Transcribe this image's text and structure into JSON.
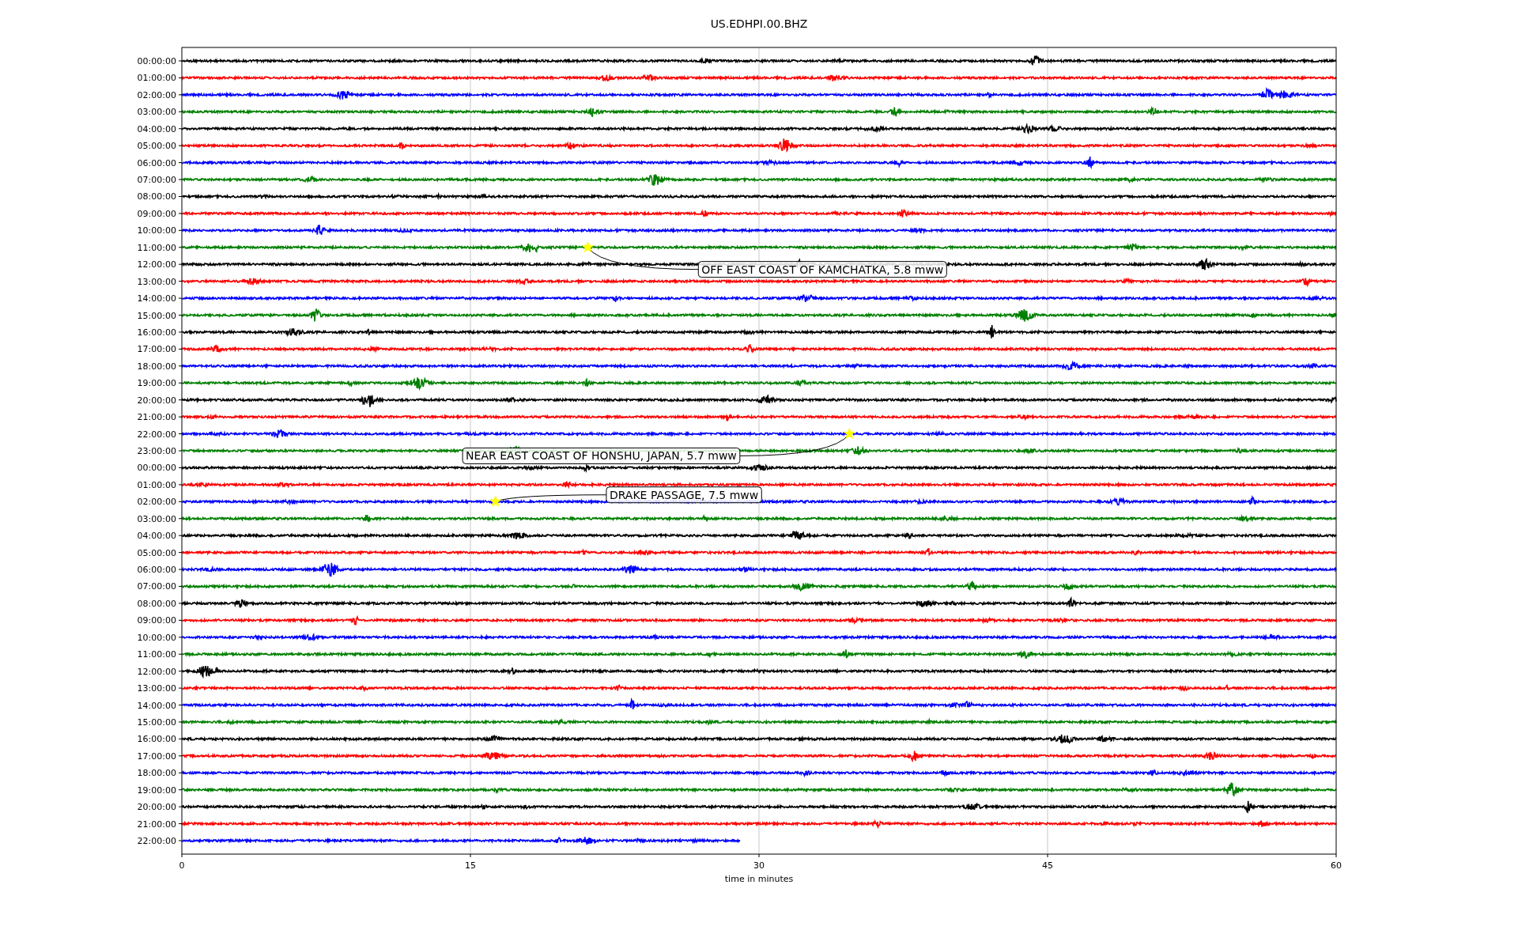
{
  "title": "US.EDHPI.00.BHZ",
  "y_labels": [
    "00:00:00",
    "01:00:00",
    "02:00:00",
    "03:00:00",
    "04:00:00",
    "05:00:00",
    "06:00:00",
    "07:00:00",
    "08:00:00",
    "09:00:00",
    "10:00:00",
    "11:00:00",
    "12:00:00",
    "13:00:00",
    "14:00:00",
    "15:00:00",
    "16:00:00",
    "17:00:00",
    "18:00:00",
    "19:00:00",
    "20:00:00",
    "21:00:00",
    "22:00:00",
    "23:00:00",
    "00:00:00",
    "01:00:00",
    "02:00:00",
    "03:00:00",
    "04:00:00",
    "05:00:00",
    "06:00:00",
    "07:00:00",
    "08:00:00",
    "09:00:00",
    "10:00:00",
    "11:00:00",
    "12:00:00",
    "13:00:00",
    "14:00:00",
    "15:00:00",
    "16:00:00",
    "17:00:00",
    "18:00:00",
    "19:00:00",
    "20:00:00",
    "21:00:00",
    "22:00:00"
  ],
  "x_tick_labels": [
    "0",
    "15",
    "30",
    "45",
    "60"
  ],
  "x_label": "time in minutes",
  "traces": [
    {
      "color": "#000000"
    },
    {
      "color": "#ff0000"
    },
    {
      "color": "#0000ff"
    },
    {
      "color": "#008000"
    },
    {
      "color": "#000000"
    },
    {
      "color": "#ff0000"
    },
    {
      "color": "#0000ff"
    },
    {
      "color": "#008000"
    },
    {
      "color": "#000000"
    },
    {
      "color": "#ff0000"
    },
    {
      "color": "#0000ff"
    },
    {
      "color": "#008000"
    },
    {
      "color": "#000000"
    },
    {
      "color": "#ff0000"
    },
    {
      "color": "#0000ff"
    },
    {
      "color": "#008000"
    },
    {
      "color": "#000000"
    },
    {
      "color": "#ff0000"
    },
    {
      "color": "#0000ff"
    },
    {
      "color": "#008000"
    },
    {
      "color": "#000000"
    },
    {
      "color": "#ff0000"
    },
    {
      "color": "#0000ff"
    },
    {
      "color": "#008000"
    },
    {
      "color": "#000000"
    },
    {
      "color": "#ff0000"
    },
    {
      "color": "#0000ff"
    },
    {
      "color": "#008000"
    },
    {
      "color": "#000000"
    },
    {
      "color": "#ff0000"
    },
    {
      "color": "#0000ff"
    },
    {
      "color": "#008000"
    },
    {
      "color": "#000000"
    },
    {
      "color": "#ff0000"
    },
    {
      "color": "#0000ff"
    },
    {
      "color": "#008000"
    },
    {
      "color": "#000000"
    },
    {
      "color": "#ff0000"
    },
    {
      "color": "#0000ff"
    },
    {
      "color": "#008000"
    },
    {
      "color": "#000000"
    },
    {
      "color": "#ff0000"
    },
    {
      "color": "#0000ff"
    },
    {
      "color": "#008000"
    },
    {
      "color": "#000000"
    },
    {
      "color": "#ff0000"
    },
    {
      "color": "#0000ff"
    }
  ],
  "events": [
    "OFF EAST COAST OF KAMCHATKA, 5.8 mww",
    "NEAR EAST COAST OF HONSHU, JAPAN, 5.7 mww",
    "DRAKE PASSAGE, 7.5 mww"
  ]
}
